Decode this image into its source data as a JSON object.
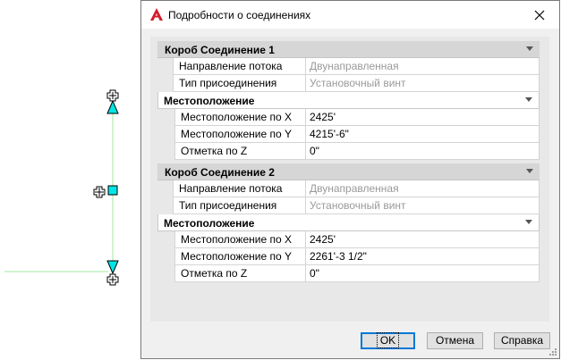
{
  "dialog": {
    "title": "Подробности о соединениях",
    "app_icon": "autocad-a-icon",
    "close_icon": "close-icon"
  },
  "connection1": {
    "header": "Короб Соединение 1",
    "flow_direction": {
      "label": "Направление потока",
      "value": "Двунаправленная"
    },
    "connection_type": {
      "label": "Тип присоединения",
      "value": "Установочный винт"
    },
    "location": {
      "header": "Местоположение",
      "x": {
        "label": "Местоположение по X",
        "value": "2425'"
      },
      "y": {
        "label": "Местоположение по Y",
        "value": "4215'-6\""
      },
      "z": {
        "label": "Отметка по Z",
        "value": "0\""
      }
    }
  },
  "connection2": {
    "header": "Короб Соединение 2",
    "flow_direction": {
      "label": "Направление потока",
      "value": "Двунаправленная"
    },
    "connection_type": {
      "label": "Тип присоединения",
      "value": "Установочный винт"
    },
    "location": {
      "header": "Местоположение",
      "x": {
        "label": "Местоположение по X",
        "value": "2425'"
      },
      "y": {
        "label": "Местоположение по Y",
        "value": "2261'-3 1/2\""
      },
      "z": {
        "label": "Отметка по Z",
        "value": "0\""
      }
    }
  },
  "buttons": {
    "ok": "OK",
    "cancel": "Отмена",
    "help": "Справка"
  },
  "colors": {
    "grip_cyan": "#00e5e5",
    "line_green": "#9ee89e",
    "ok_border": "#0078d7"
  }
}
